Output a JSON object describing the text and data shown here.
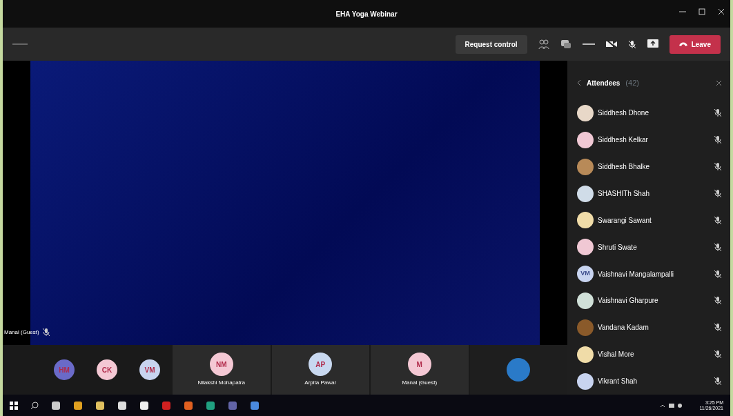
{
  "window": {
    "title": "EHA Yoga Webinar"
  },
  "toolbar": {
    "request_control": "Request control",
    "leave": "Leave"
  },
  "video": {
    "caption": "Manal (Guest)"
  },
  "attendees_panel": {
    "title": "Attendees",
    "count": "(42)",
    "attendees": [
      {
        "name": "Siddhesh Dhone",
        "avatar": {
          "kind": "photo",
          "color": "#e8d8c8"
        }
      },
      {
        "name": "Siddhesh Kelkar",
        "avatar": {
          "kind": "photo",
          "color": "#f0c8d4"
        }
      },
      {
        "name": "Siddhesh Bhalke",
        "avatar": {
          "kind": "photo",
          "color": "#b88a58"
        }
      },
      {
        "name": "SHASHITh Shah",
        "avatar": {
          "kind": "photo",
          "color": "#d0dce8"
        }
      },
      {
        "name": "Swarangi Sawant",
        "avatar": {
          "kind": "photo",
          "color": "#f0dca8"
        }
      },
      {
        "name": "Shruti Swate",
        "avatar": {
          "kind": "photo",
          "color": "#f0c8d4"
        }
      },
      {
        "name": "Vaishnavi Mangalampalli",
        "avatar": {
          "kind": "initials",
          "initials": "VM",
          "color": "#c8d4f0"
        }
      },
      {
        "name": "Vaishnavi Gharpure",
        "avatar": {
          "kind": "photo",
          "color": "#d0e0d8"
        }
      },
      {
        "name": "Vandana Kadam",
        "avatar": {
          "kind": "photo",
          "color": "#8a5a2a"
        }
      },
      {
        "name": "Vishal More",
        "avatar": {
          "kind": "photo",
          "color": "#f0dca8"
        }
      },
      {
        "name": "Vikrant Shah",
        "avatar": {
          "kind": "photo",
          "color": "#c8d4f0"
        }
      }
    ]
  },
  "participant_strip": [
    {
      "kind": "small",
      "initials": "HM",
      "color": "#6a6ac8"
    },
    {
      "kind": "small",
      "initials": "CK",
      "color": "#f4c8d4"
    },
    {
      "kind": "small",
      "initials": "VM",
      "color": "#c8d4f0"
    },
    {
      "kind": "tile",
      "initials": "NM",
      "name": "Nilakshi Mohapatra",
      "color": "#f4c8d4"
    },
    {
      "kind": "tile",
      "initials": "AP",
      "name": "Arpita Pawar",
      "color": "#c8d8f0"
    },
    {
      "kind": "tile",
      "initials": "M",
      "name": "Manal (Guest)",
      "color": "#f4c8d4"
    },
    {
      "kind": "photo",
      "color": "#2a7ac8"
    }
  ],
  "taskbar": {
    "time": "3:25 PM",
    "date": "11/26/2021"
  }
}
